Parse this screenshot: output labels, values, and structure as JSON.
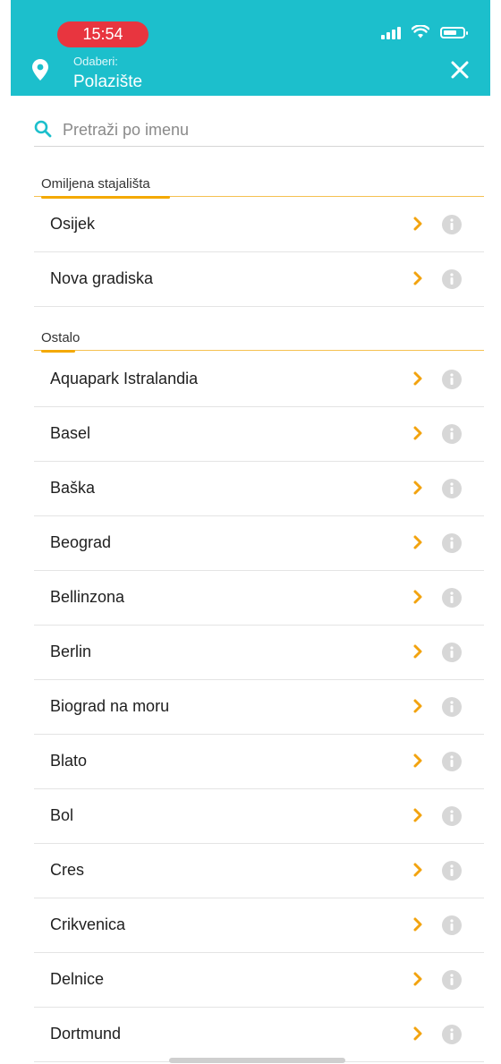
{
  "status_bar": {
    "time": "15:54"
  },
  "header": {
    "subtitle": "Odaberi:",
    "title": "Polazište",
    "close_icon": "close-icon",
    "location_icon": "location-pin-icon",
    "accent": "#1cbfcc"
  },
  "search": {
    "placeholder": "Pretraži po imenu",
    "value": ""
  },
  "favorites": {
    "label": "Omiljena stajališta",
    "items": [
      {
        "name": "Osijek"
      },
      {
        "name": "Nova gradiska"
      }
    ]
  },
  "others": {
    "label": "Ostalo",
    "items": [
      {
        "name": "Aquapark Istralandia"
      },
      {
        "name": "Basel"
      },
      {
        "name": "Baška"
      },
      {
        "name": "Beograd"
      },
      {
        "name": "Bellinzona"
      },
      {
        "name": "Berlin"
      },
      {
        "name": "Biograd na moru"
      },
      {
        "name": "Blato"
      },
      {
        "name": "Bol"
      },
      {
        "name": "Cres"
      },
      {
        "name": "Crikvenica"
      },
      {
        "name": "Delnice"
      },
      {
        "name": "Dortmund"
      }
    ]
  },
  "colors": {
    "chevron": "#f2a30f",
    "info": "#d7d7d7",
    "section_line": "#f4a900"
  }
}
